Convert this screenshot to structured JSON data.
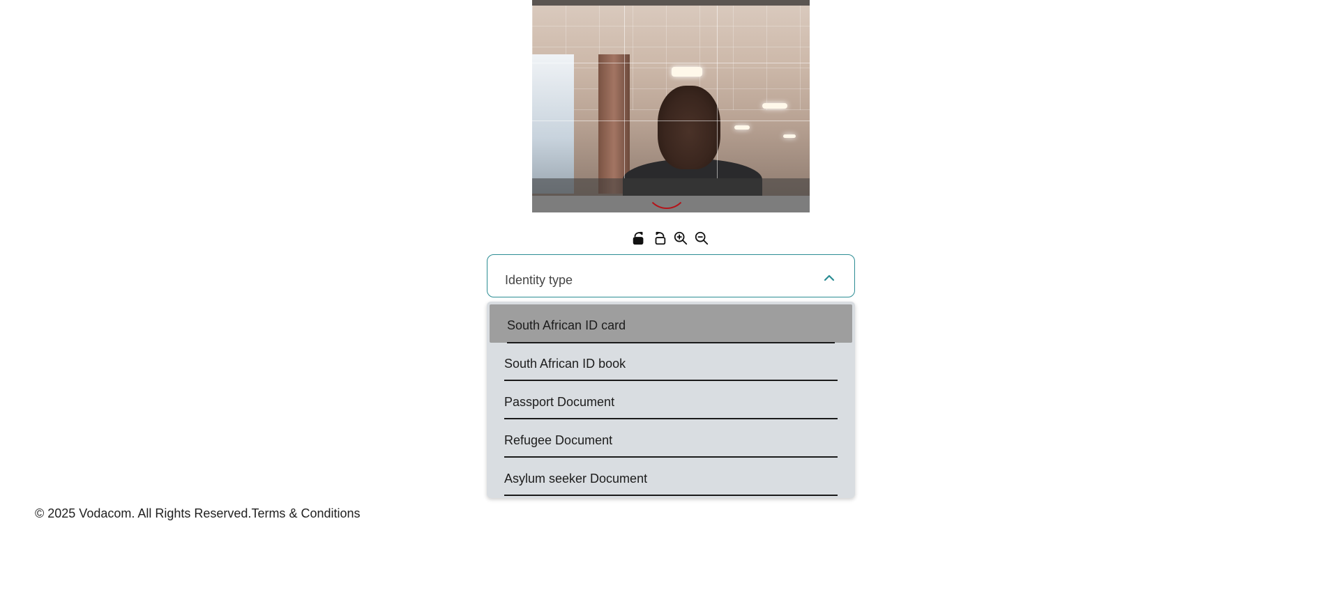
{
  "toolbar": {
    "icons": [
      "rotate-right-icon",
      "rotate-left-icon",
      "zoom-in-icon",
      "zoom-out-icon"
    ]
  },
  "identity_select": {
    "label": "Identity type",
    "expanded": true,
    "options": [
      "South African ID card",
      "South African ID book",
      "Passport Document",
      "Refugee Document",
      "Asylum seeker Document"
    ],
    "highlighted_option": "South African ID card"
  },
  "footer": {
    "copyright": "© 2025 Vodacom. All Rights Reserved.",
    "terms_link": "Terms & Conditions"
  },
  "colors": {
    "select_border": "#2a8c93",
    "dropdown_bg": "#d9dde1",
    "highlight_bg": "#9e9e9e",
    "capture_ring": "#b4141a"
  }
}
